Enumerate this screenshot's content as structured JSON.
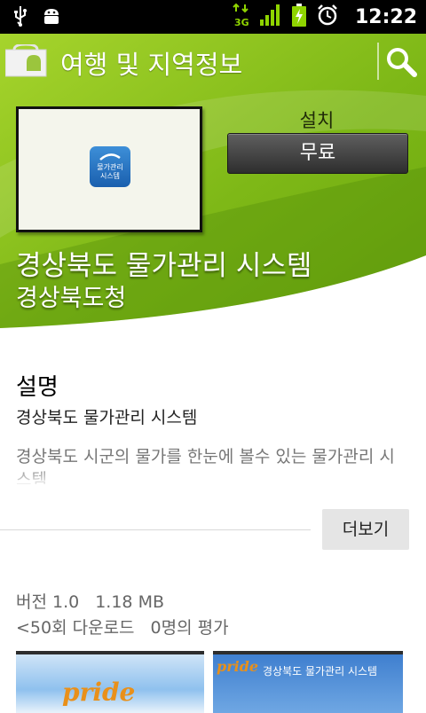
{
  "status_bar": {
    "time": "12:22",
    "network": "3G",
    "icons": [
      "usb-icon",
      "android-debug-icon",
      "network-3g-icon",
      "signal-icon",
      "battery-charging-icon",
      "alarm-icon"
    ]
  },
  "action_bar": {
    "category_title": "여행 및 지역정보",
    "search_icon": "search-icon"
  },
  "app": {
    "install_label": "설치",
    "price_button": "무료",
    "name": "경상북도 물가관리 시스템",
    "developer": "경상북도청",
    "thumbnail_logo_line1": "물가관리",
    "thumbnail_logo_line2": "시스템"
  },
  "description": {
    "heading": "설명",
    "subtitle": "경상북도 물가관리 시스템",
    "body": "경상북도 시군의 물가를 한눈에 볼수 있는 물가관리 시스템",
    "more_button": "더보기"
  },
  "meta": {
    "version": "버전 1.0",
    "size": "1.18 MB",
    "downloads": "<50회 다운로드",
    "ratings": "0명의 평가"
  },
  "screenshots": {
    "shot1_logo": "pride",
    "shot2_logo": "pride",
    "shot2_title": "경상북도 물가관리 시스템"
  },
  "colors": {
    "header_green": "#8dc21f",
    "status_bar": "#000000",
    "button_dark": "#3a3a3a"
  }
}
